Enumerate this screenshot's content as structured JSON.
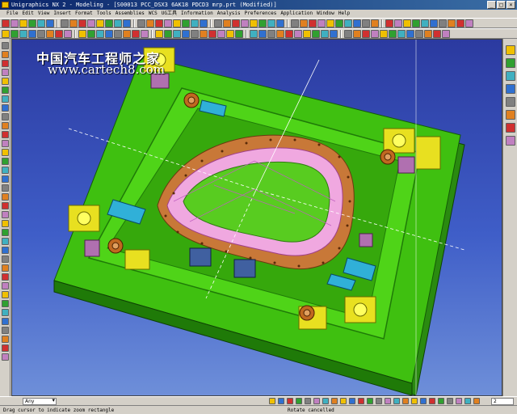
{
  "window": {
    "title": "Unigraphics NX 2 - Modeling - [S00013 PCC_DSX3 6AK18 PDCD3 mrp.prt (Modified)]"
  },
  "menu": [
    "File",
    "Edit",
    "View",
    "Insert",
    "Format",
    "Tools",
    "Assemblies",
    "WCS",
    "UG工具",
    "Information",
    "Analysis",
    "Preferences",
    "Application",
    "Window",
    "Help"
  ],
  "watermark": {
    "title": "中国汽车工程师之家",
    "url": "www.cartech8.com"
  },
  "selection_bar": {
    "filter_value": "Any",
    "spinner_value": "2"
  },
  "status": {
    "left": "Drag cursor to indicate zoom rectangle",
    "middle": "Rotate cancelled"
  },
  "colors": {
    "viewport_top": "#2b3aa0",
    "viewport_bottom": "#6e8fd9",
    "die_green": "#3fc010",
    "die_dark_green": "#1f7a08",
    "clamp_yellow": "#e8e020",
    "panel_pink": "#f0a8e0",
    "flange_brown": "#c87838",
    "accent_cyan": "#30b0d8"
  }
}
